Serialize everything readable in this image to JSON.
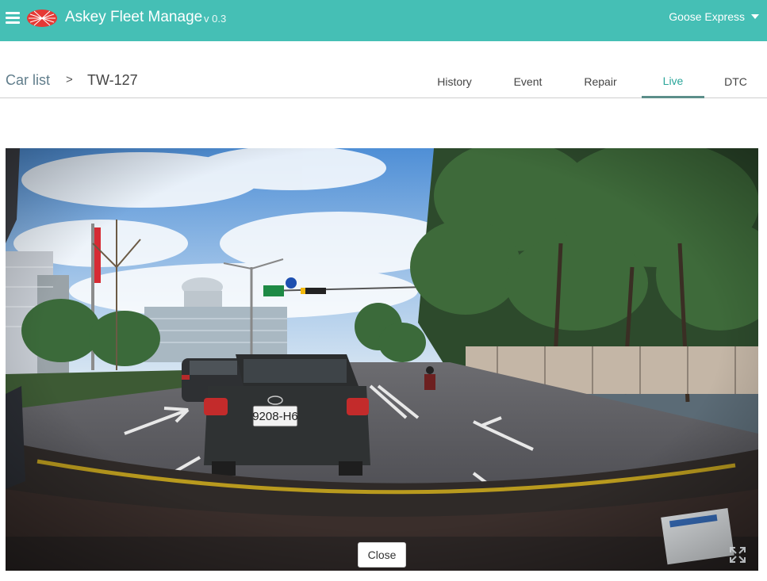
{
  "header": {
    "app_title": "Askey Fleet Manage",
    "version": "v 0.3",
    "company": "Goose Express",
    "brand_color": "#45bfb5"
  },
  "breadcrumb": {
    "link": "Car list",
    "separator": ">",
    "current": "TW-127"
  },
  "tabs": [
    {
      "label": "History",
      "active": false
    },
    {
      "label": "Event",
      "active": false
    },
    {
      "label": "Repair",
      "active": false
    },
    {
      "label": "Live",
      "active": true
    },
    {
      "label": "DTC",
      "active": false
    }
  ],
  "video": {
    "close_label": "Close",
    "plate": "9208-H6"
  }
}
